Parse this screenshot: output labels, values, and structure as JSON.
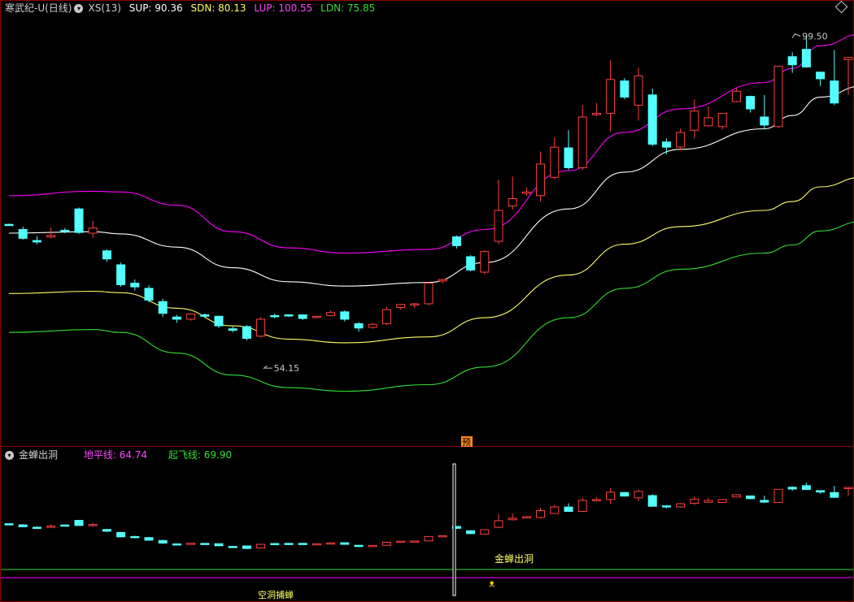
{
  "top_header": {
    "title": "寒武纪-U(日线)",
    "indicator": "XS(13)",
    "sup": "SUP: 90.36",
    "sdn": "SDN: 80.13",
    "lup": "LUP: 100.55",
    "ldn": "LDN: 75.85"
  },
  "bottom_header": {
    "title": "金蝉出洞",
    "ground": "地平线: 64.74",
    "takeoff": "起飞线: 69.90"
  },
  "annotations": {
    "high": "99.50",
    "low": "54.15",
    "badge": "预",
    "bull_signal": "金蝉出洞",
    "bear_signal": "空洞捕蝉"
  },
  "colors": {
    "up": "#ff4040",
    "down": "#54ffff",
    "sup": "#ffffff",
    "sdn": "#ffff66",
    "lup": "#ff00ff",
    "ldn": "#33dd33"
  },
  "chart_data": {
    "type": "candlestick",
    "ylim": [
      44,
      102
    ],
    "candles": [
      [
        73.7,
        73.8,
        73.6,
        73.5
      ],
      [
        73.0,
        73.4,
        71.8,
        71.6
      ],
      [
        71.5,
        72.1,
        71.3,
        71.0
      ],
      [
        72.0,
        73.3,
        72.2,
        71.8
      ],
      [
        72.9,
        73.2,
        72.8,
        72.5
      ],
      [
        75.8,
        76.0,
        72.6,
        72.4
      ],
      [
        72.5,
        74.2,
        73.2,
        71.9
      ],
      [
        70.1,
        70.3,
        69.0,
        68.6
      ],
      [
        68.2,
        68.5,
        65.5,
        65.2
      ],
      [
        65.7,
        66.2,
        65.2,
        64.7
      ],
      [
        65.0,
        65.4,
        63.4,
        63.1
      ],
      [
        63.2,
        63.6,
        61.6,
        61.1
      ],
      [
        61.1,
        61.4,
        60.8,
        60.3
      ],
      [
        60.8,
        61.6,
        61.5,
        60.6
      ],
      [
        61.4,
        61.6,
        61.2,
        61.0
      ],
      [
        61.2,
        61.3,
        59.9,
        59.6
      ],
      [
        59.5,
        59.8,
        59.3,
        59.0
      ],
      [
        59.8,
        60.0,
        58.2,
        57.9
      ],
      [
        58.5,
        61.1,
        60.8,
        58.3
      ],
      [
        61.3,
        61.6,
        61.2,
        60.9
      ],
      [
        61.4,
        61.5,
        61.3,
        61.1
      ],
      [
        61.4,
        61.5,
        60.9,
        60.7
      ],
      [
        61.1,
        61.2,
        61.2,
        60.9
      ],
      [
        61.3,
        62.0,
        61.7,
        61.2
      ],
      [
        61.8,
        62.0,
        60.8,
        60.5
      ],
      [
        60.2,
        60.4,
        59.6,
        59.1
      ],
      [
        59.7,
        60.3,
        60.1,
        59.5
      ],
      [
        60.2,
        62.5,
        62.1,
        60.0
      ],
      [
        62.4,
        62.9,
        62.8,
        62.1
      ],
      [
        62.8,
        63.0,
        62.9,
        62.3
      ],
      [
        62.9,
        65.8,
        65.7,
        62.7
      ],
      [
        66.0,
        66.3,
        66.2,
        65.7
      ],
      [
        72.0,
        72.2,
        70.8,
        70.4
      ],
      [
        69.3,
        69.5,
        67.5,
        67.3
      ],
      [
        67.2,
        70.2,
        70.0,
        66.9
      ],
      [
        71.4,
        79.8,
        75.6,
        71.0
      ],
      [
        76.2,
        80.2,
        77.2,
        75.7
      ],
      [
        77.9,
        78.7,
        78.1,
        77.6
      ],
      [
        77.6,
        83.6,
        81.9,
        76.8
      ],
      [
        80.1,
        85.5,
        84.2,
        79.8
      ],
      [
        84.1,
        86.5,
        81.4,
        81.1
      ],
      [
        81.4,
        89.9,
        88.3,
        81.1
      ],
      [
        88.6,
        90.2,
        88.8,
        88.4
      ],
      [
        88.8,
        96.0,
        93.4,
        86.3
      ],
      [
        93.2,
        93.6,
        91.0,
        90.7
      ],
      [
        89.9,
        95.0,
        93.9,
        87.8
      ],
      [
        91.3,
        92.2,
        84.6,
        84.3
      ],
      [
        84.9,
        85.4,
        84.2,
        83.2
      ],
      [
        84.2,
        86.7,
        86.2,
        83.8
      ],
      [
        86.5,
        90.7,
        89.1,
        85.4
      ],
      [
        87.1,
        89.7,
        88.2,
        87.0
      ],
      [
        87.0,
        87.5,
        88.8,
        86.6
      ],
      [
        90.4,
        92.2,
        91.8,
        90.3
      ],
      [
        91.1,
        91.2,
        89.4,
        88.9
      ],
      [
        88.3,
        91.3,
        87.2,
        86.6
      ],
      [
        87.0,
        87.6,
        95.2,
        86.8
      ],
      [
        96.5,
        97.1,
        95.4,
        94.3
      ],
      [
        97.5,
        99.4,
        95.1,
        95.0
      ],
      [
        94.4,
        94.4,
        93.5,
        92.5
      ],
      [
        93.2,
        97.4,
        90.2,
        89.9
      ],
      [
        96.1,
        96.3,
        96.4,
        91.3
      ],
      [
        92.3,
        94.8,
        91.8,
        95.2
      ]
    ],
    "lines": {
      "lup": [
        [
          0,
          77.6
        ],
        [
          6,
          78.2
        ],
        [
          8,
          78.1
        ],
        [
          12,
          76.3
        ],
        [
          16,
          72.7
        ],
        [
          20,
          70.5
        ],
        [
          24,
          69.8
        ],
        [
          30,
          70.3
        ],
        [
          34,
          73.0
        ],
        [
          40,
          81.0
        ],
        [
          44,
          86.2
        ],
        [
          48,
          89.4
        ],
        [
          54,
          93.0
        ],
        [
          56,
          94.9
        ],
        [
          58,
          98.0
        ],
        [
          61,
          99.6
        ]
      ],
      "sup": [
        [
          0,
          72.5
        ],
        [
          6,
          72.7
        ],
        [
          8,
          72.4
        ],
        [
          12,
          70.6
        ],
        [
          16,
          67.8
        ],
        [
          20,
          65.9
        ],
        [
          24,
          65.3
        ],
        [
          30,
          65.8
        ],
        [
          34,
          68.5
        ],
        [
          40,
          75.8
        ],
        [
          44,
          80.8
        ],
        [
          48,
          83.9
        ],
        [
          54,
          86.7
        ],
        [
          56,
          88.5
        ],
        [
          58,
          91.0
        ],
        [
          61,
          92.5
        ]
      ],
      "sdn": [
        [
          0,
          64.3
        ],
        [
          6,
          64.6
        ],
        [
          8,
          64.4
        ],
        [
          12,
          62.3
        ],
        [
          16,
          59.9
        ],
        [
          20,
          58.1
        ],
        [
          24,
          57.6
        ],
        [
          30,
          58.4
        ],
        [
          34,
          61.0
        ],
        [
          40,
          66.8
        ],
        [
          44,
          71.0
        ],
        [
          48,
          73.4
        ],
        [
          54,
          75.6
        ],
        [
          56,
          76.8
        ],
        [
          58,
          78.8
        ],
        [
          61,
          80.1
        ]
      ],
      "ldn": [
        [
          0,
          59.0
        ],
        [
          6,
          59.4
        ],
        [
          8,
          59.0
        ],
        [
          12,
          56.2
        ],
        [
          16,
          53.2
        ],
        [
          20,
          51.5
        ],
        [
          24,
          51.0
        ],
        [
          30,
          51.9
        ],
        [
          34,
          54.3
        ],
        [
          40,
          61.0
        ],
        [
          44,
          65.0
        ],
        [
          48,
          67.6
        ],
        [
          54,
          69.8
        ],
        [
          56,
          70.9
        ],
        [
          58,
          72.8
        ],
        [
          61,
          74.1
        ]
      ]
    },
    "sub": {
      "ground": 64.74,
      "takeoff": 69.9,
      "ylim": [
        55,
        100
      ]
    }
  }
}
